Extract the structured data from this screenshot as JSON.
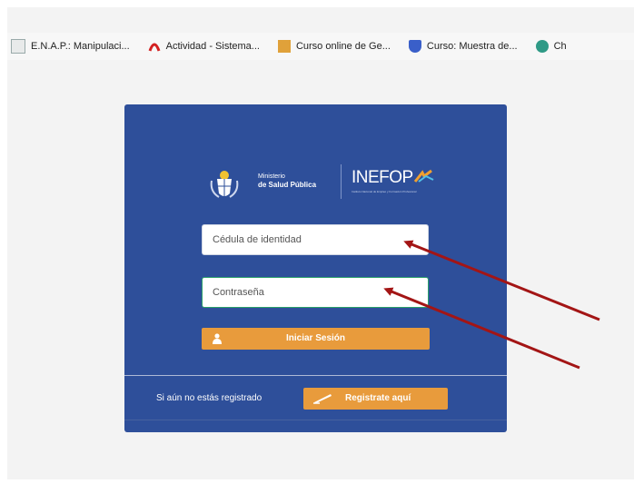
{
  "bookmarks": [
    {
      "label": "E.N.A.P.: Manipulaci...",
      "icon": "document-icon"
    },
    {
      "label": "Actividad - Sistema...",
      "icon": "arc-icon"
    },
    {
      "label": "Curso online de Ge...",
      "icon": "course-icon"
    },
    {
      "label": "Curso: Muestra de...",
      "icon": "shield-icon"
    },
    {
      "label": "Ch",
      "icon": "globe-icon"
    }
  ],
  "login": {
    "ministry_line1": "Ministerio",
    "ministry_line2": "de Salud Pública",
    "brand": "INEFOP",
    "brand_sub": "Instituto Nacional de Empleo y Formación Profesional",
    "cedula_placeholder": "Cédula de identidad",
    "password_placeholder": "Contraseña",
    "login_label": "Iniciar Sesión",
    "register_prompt": "Si aún no estás registrado",
    "register_label": "Registrate aquí"
  },
  "colors": {
    "card": "#2e4f9a",
    "accent": "#e89b3c",
    "arrow": "#a31515"
  }
}
